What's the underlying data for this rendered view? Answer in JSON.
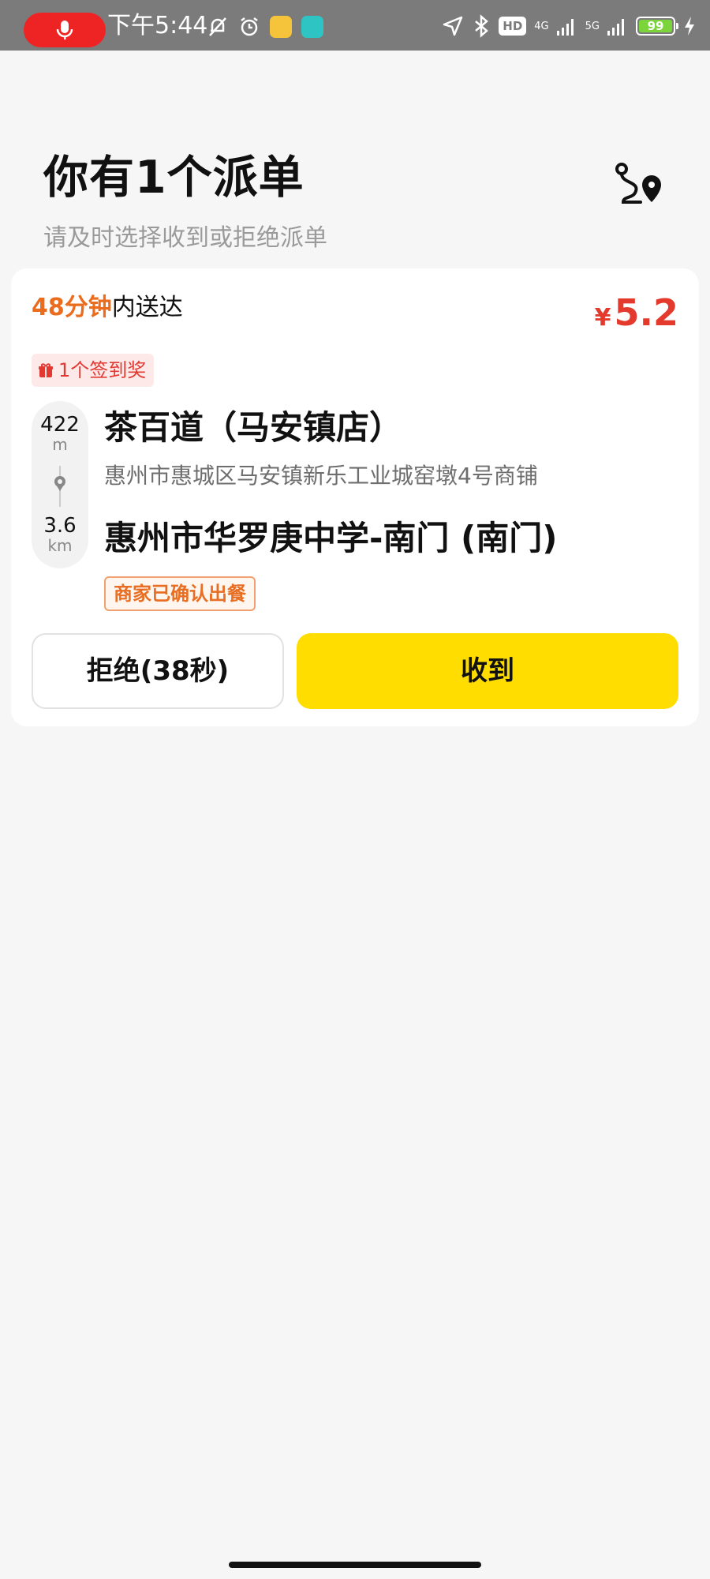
{
  "status_bar": {
    "time": "下午5:44",
    "hd_label": "HD",
    "network_1": "4G",
    "network_2": "5G",
    "battery": "99",
    "icons": [
      "mic-icon",
      "bell-off-icon",
      "alarm-icon",
      "app-icon",
      "app-icon-2",
      "location-arrow-icon",
      "bluetooth-icon",
      "hd-icon",
      "signal-icon",
      "battery-icon",
      "charging-icon"
    ]
  },
  "header": {
    "title": "你有1个派单",
    "subtitle": "请及时选择收到或拒绝派单"
  },
  "order": {
    "eta_minutes": "48分钟",
    "eta_suffix": "内送达",
    "price_symbol": "¥",
    "price": "5.2",
    "bonus_tag": "1个签到奖",
    "distance_to_store_value": "422",
    "distance_to_store_unit": "m",
    "distance_to_dest_value": "3.6",
    "distance_to_dest_unit": "km",
    "store_name": "茶百道（马安镇店）",
    "store_address": "惠州市惠城区马安镇新乐工业城窑墩4号商铺",
    "destination": "惠州市华罗庚中学-南门 (南门)",
    "status": "商家已确认出餐"
  },
  "actions": {
    "reject_label": "拒绝(38秒)",
    "accept_label": "收到"
  },
  "colors": {
    "accent_yellow": "#ffdd00",
    "price_red": "#e43a2e",
    "eta_orange": "#ec6c1e"
  }
}
